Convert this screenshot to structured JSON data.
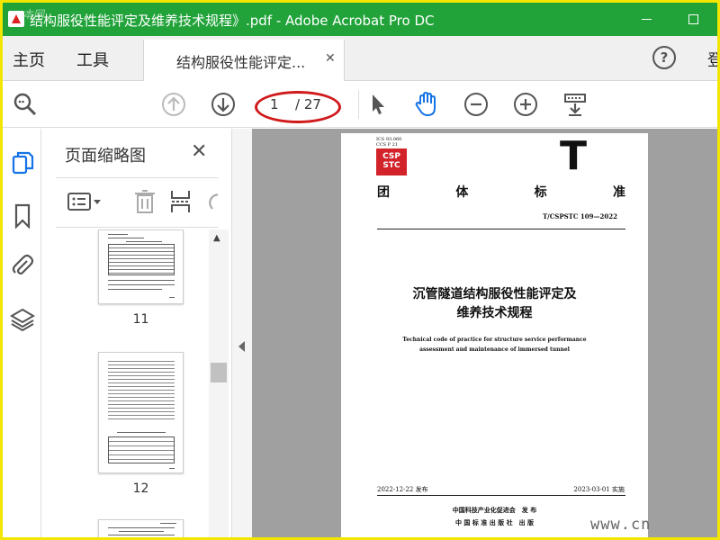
{
  "window": {
    "title": "结构服役性能评定及维养技术规程》.pdf - Adobe Acrobat Pro DC",
    "watermark_top": "本网"
  },
  "menu": {
    "home": "主页",
    "tools": "工具",
    "doc_tab": "结构服役性能评定...",
    "signin_partial": "登"
  },
  "toolbar": {
    "current_page": "1",
    "total_pages": "/ 27"
  },
  "thumbnails": {
    "title": "页面缩略图",
    "pages": [
      "11",
      "12"
    ]
  },
  "document": {
    "std_codes": [
      "ICS 93.060",
      "CCS P 21"
    ],
    "logo_text": [
      "CSP",
      "STC"
    ],
    "std_letter": "T",
    "std_type": [
      "团",
      "体",
      "标",
      "准"
    ],
    "std_number": "T/CSPSTC 109—2022",
    "title_cn": [
      "沉管隧道结构服役性能评定及",
      "维养技术规程"
    ],
    "title_en": [
      "Technical code of practice for structure service performance",
      "assessment and maintenance of immersed tunnel"
    ],
    "issue_date": "2022-12-22 发布",
    "impl_date": "2023-03-01 实施",
    "publisher": [
      "中国科技产业化促进会　发 布",
      "中 国 标 准 出 版 社　出 版"
    ]
  },
  "watermark_bottom": "www.cn",
  "colors": {
    "titlebar": "#21a33a",
    "border": "#f2e600",
    "hand_tool": "#1473e6",
    "annotation": "#d0191b"
  }
}
